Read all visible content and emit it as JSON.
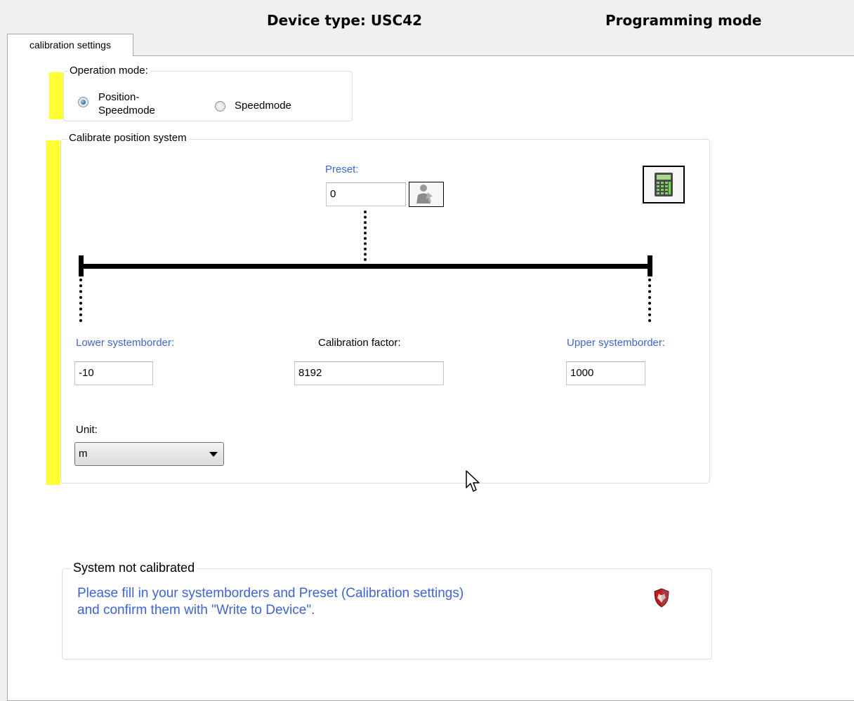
{
  "header": {
    "device_type": "Device type: USC42",
    "mode": "Programming mode"
  },
  "tabs": [
    {
      "label": "calibration settings",
      "active": true
    }
  ],
  "operation_mode": {
    "title": "Operation mode:",
    "options": [
      {
        "label_line1": "Position-",
        "label_line2": "Speedmode",
        "selected": true
      },
      {
        "label": "Speedmode",
        "selected": false
      }
    ]
  },
  "calibrate": {
    "title": "Calibrate position system",
    "preset_label": "Preset:",
    "preset_value": "0",
    "lower_label": "Lower  systemborder:",
    "lower_value": "-10",
    "factor_label": "Calibration factor:",
    "factor_value": "8192",
    "upper_label": "Upper systemborder:",
    "upper_value": "1000",
    "unit_label": "Unit:",
    "unit_value": "m"
  },
  "status": {
    "title": "System not calibrated",
    "message_line1": "Please fill in your systemborders and Preset (Calibration settings)",
    "message_line2": "and confirm them with \"Write to Device\"."
  },
  "colors": {
    "accent_yellow": "#ffff33",
    "label_blue": "#3b63e8"
  },
  "icons": [
    "preset-set-icon",
    "calculator-icon",
    "shield-warning-icon",
    "radio-selected-icon",
    "radio-unselected-icon",
    "dropdown-arrow-icon",
    "mouse-cursor-icon"
  ]
}
